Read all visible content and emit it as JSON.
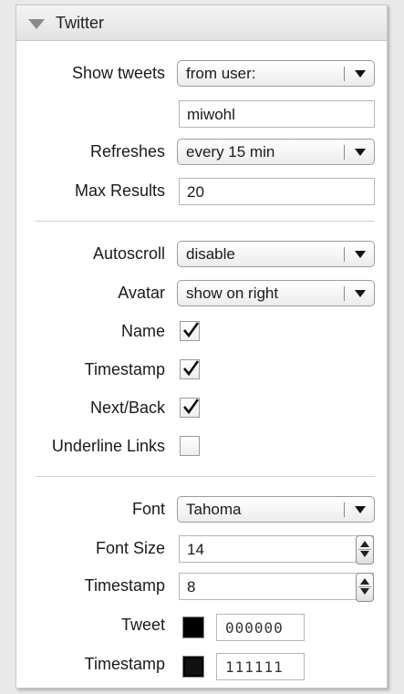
{
  "panel": {
    "title": "Twitter"
  },
  "rows": {
    "show_tweets": {
      "label": "Show tweets",
      "value": "from user:"
    },
    "username": {
      "value": "miwohl"
    },
    "refreshes": {
      "label": "Refreshes",
      "value": "every 15 min"
    },
    "max_results": {
      "label": "Max Results",
      "value": "20"
    },
    "autoscroll": {
      "label": "Autoscroll",
      "value": "disable"
    },
    "avatar": {
      "label": "Avatar",
      "value": "show on right"
    },
    "name": {
      "label": "Name",
      "checked": true
    },
    "timestamp_cb": {
      "label": "Timestamp",
      "checked": true
    },
    "nextback": {
      "label": "Next/Back",
      "checked": true
    },
    "underline_links": {
      "label": "Underline Links",
      "checked": false
    },
    "font": {
      "label": "Font",
      "value": "Tahoma"
    },
    "font_size": {
      "label": "Font Size",
      "value": "14"
    },
    "timestamp_size": {
      "label": "Timestamp",
      "value": "8"
    },
    "tweet_color": {
      "label": "Tweet",
      "value": "000000",
      "color": "#000000"
    },
    "timestamp_color": {
      "label": "Timestamp",
      "value": "111111",
      "color": "#111111"
    }
  }
}
